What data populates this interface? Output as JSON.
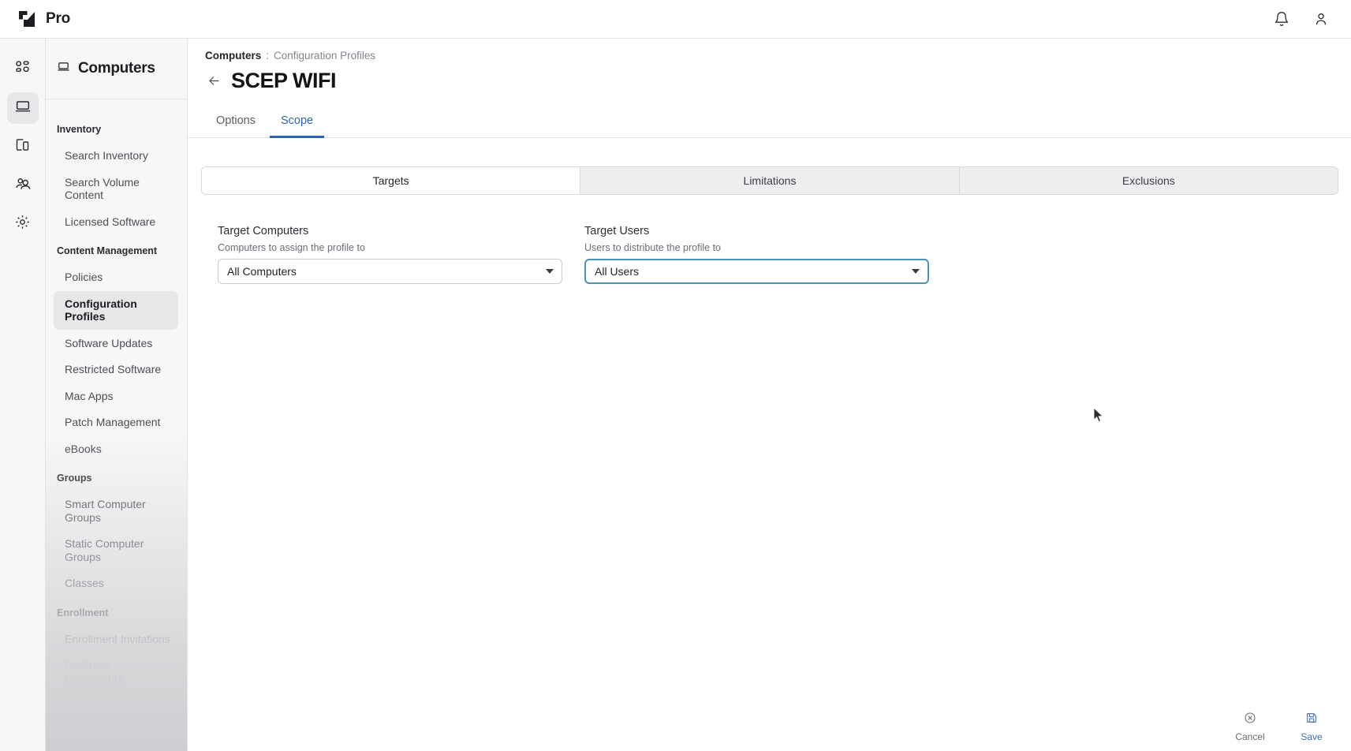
{
  "app": {
    "brand_name": "Pro",
    "logo_icon": "jamf-logo-icon"
  },
  "topbar": {
    "notifications_icon": "bell-icon",
    "account_icon": "user-account-icon"
  },
  "rail": {
    "items": [
      {
        "name": "dashboard",
        "icon": "grid-dashboard-icon",
        "active": false
      },
      {
        "name": "computers",
        "icon": "laptop-icon",
        "active": true
      },
      {
        "name": "devices",
        "icon": "mobile-devices-icon",
        "active": false
      },
      {
        "name": "users",
        "icon": "users-icon",
        "active": false
      },
      {
        "name": "settings",
        "icon": "gear-icon",
        "active": false
      }
    ]
  },
  "sidebar": {
    "header_title": "Computers",
    "header_icon": "laptop-icon",
    "groups": [
      {
        "label": "Inventory",
        "items": [
          {
            "label": "Search Inventory",
            "active": false
          },
          {
            "label": "Search Volume Content",
            "active": false
          },
          {
            "label": "Licensed Software",
            "active": false
          }
        ]
      },
      {
        "label": "Content Management",
        "items": [
          {
            "label": "Policies",
            "active": false
          },
          {
            "label": "Configuration Profiles",
            "active": true
          },
          {
            "label": "Software Updates",
            "active": false
          },
          {
            "label": "Restricted Software",
            "active": false
          },
          {
            "label": "Mac Apps",
            "active": false
          },
          {
            "label": "Patch Management",
            "active": false
          },
          {
            "label": "eBooks",
            "active": false
          }
        ]
      },
      {
        "label": "Groups",
        "items": [
          {
            "label": "Smart Computer Groups",
            "active": false
          },
          {
            "label": "Static Computer Groups",
            "active": false
          },
          {
            "label": "Classes",
            "active": false
          }
        ]
      },
      {
        "label": "Enrollment",
        "items": [
          {
            "label": "Enrollment Invitations",
            "active": false
          },
          {
            "label": "PreStage Enrollments",
            "active": false
          }
        ]
      }
    ]
  },
  "page": {
    "breadcrumb_root": "Computers",
    "breadcrumb_separator": ":",
    "breadcrumb_current": "Configuration Profiles",
    "back_icon": "arrow-left-icon",
    "title": "SCEP WIFI"
  },
  "tabs": [
    {
      "label": "Options",
      "active": false
    },
    {
      "label": "Scope",
      "active": true
    }
  ],
  "scope_tabs": [
    {
      "label": "Targets",
      "active": true
    },
    {
      "label": "Limitations",
      "active": false
    },
    {
      "label": "Exclusions",
      "active": false
    }
  ],
  "form": {
    "target_computers": {
      "label": "Target Computers",
      "help": "Computers to assign the profile to",
      "value": "All Computers",
      "focused": false
    },
    "target_users": {
      "label": "Target Users",
      "help": "Users to distribute the profile to",
      "value": "All Users",
      "focused": true
    }
  },
  "bottombar": {
    "cancel_label": "Cancel",
    "cancel_icon": "circle-x-icon",
    "save_label": "Save",
    "save_icon": "floppy-disk-save-icon"
  },
  "colors": {
    "accent_blue": "#2e63b3",
    "focus_border": "#4b93b8",
    "save_blue": "#3f6fb8",
    "sidebar_bg": "#f7f7f8"
  }
}
